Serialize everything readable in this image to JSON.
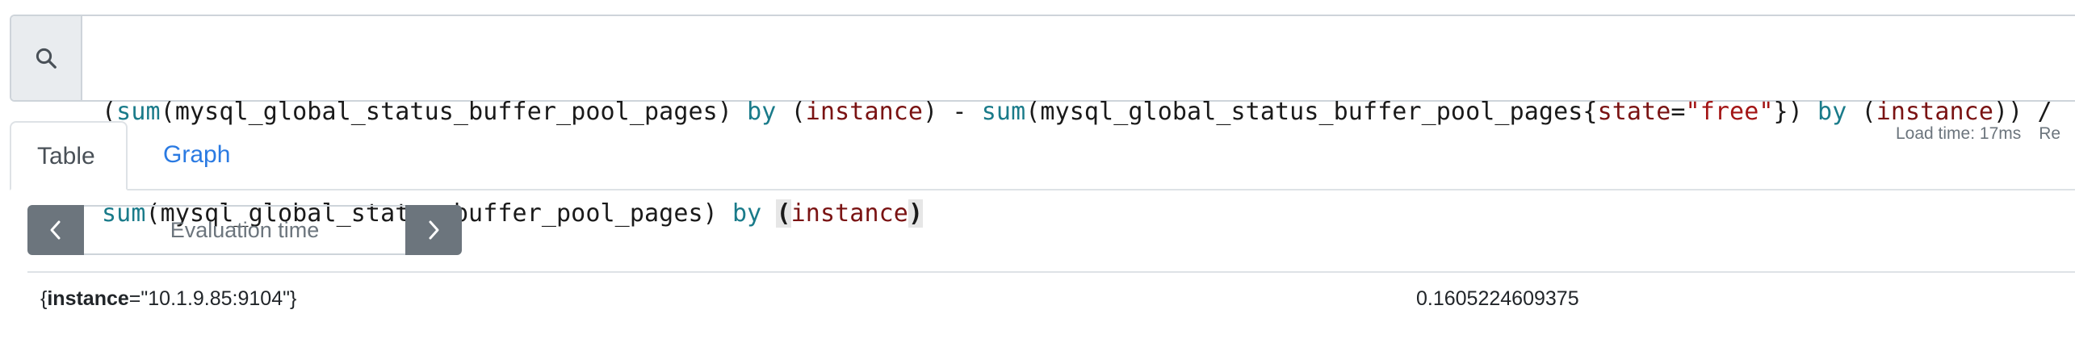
{
  "query": {
    "line1": [
      {
        "t": "(",
        "c": ""
      },
      {
        "t": "sum",
        "c": "fn"
      },
      {
        "t": "(mysql_global_status_buffer_pool_pages) ",
        "c": ""
      },
      {
        "t": "by",
        "c": "kw"
      },
      {
        "t": " (",
        "c": ""
      },
      {
        "t": "instance",
        "c": "lbl"
      },
      {
        "t": ") - ",
        "c": ""
      },
      {
        "t": "sum",
        "c": "fn"
      },
      {
        "t": "(mysql_global_status_buffer_pool_pages{",
        "c": ""
      },
      {
        "t": "state",
        "c": "lbl"
      },
      {
        "t": "=",
        "c": ""
      },
      {
        "t": "\"free\"",
        "c": "str"
      },
      {
        "t": "}) ",
        "c": ""
      },
      {
        "t": "by",
        "c": "kw"
      },
      {
        "t": " (",
        "c": ""
      },
      {
        "t": "instance",
        "c": "lbl"
      },
      {
        "t": ")) /",
        "c": ""
      }
    ],
    "line2": [
      {
        "t": "sum",
        "c": "fn"
      },
      {
        "t": "(mysql_global_status_buffer_pool_pages) ",
        "c": ""
      },
      {
        "t": "by",
        "c": "kw"
      },
      {
        "t": " ",
        "c": ""
      },
      {
        "t": "(",
        "c": "match"
      },
      {
        "t": "instance",
        "c": "lbl"
      },
      {
        "t": ")",
        "c": "match"
      }
    ]
  },
  "tabs": {
    "table_label": "Table",
    "graph_label": "Graph"
  },
  "status": {
    "load_time": "Load time: 17ms",
    "trailing": "Re"
  },
  "eval": {
    "placeholder": "Evaluation time"
  },
  "result": {
    "metric_open": "{",
    "label_name": "instance",
    "label_eq": "=",
    "label_value": "\"10.1.9.85:9104\"",
    "metric_close": "}",
    "value": "0.1605224609375"
  },
  "colors": {
    "function": "#1a7b8a",
    "label": "#7a1313",
    "string": "#a31515",
    "link": "#2a7ae2",
    "button": "#6c757d"
  }
}
